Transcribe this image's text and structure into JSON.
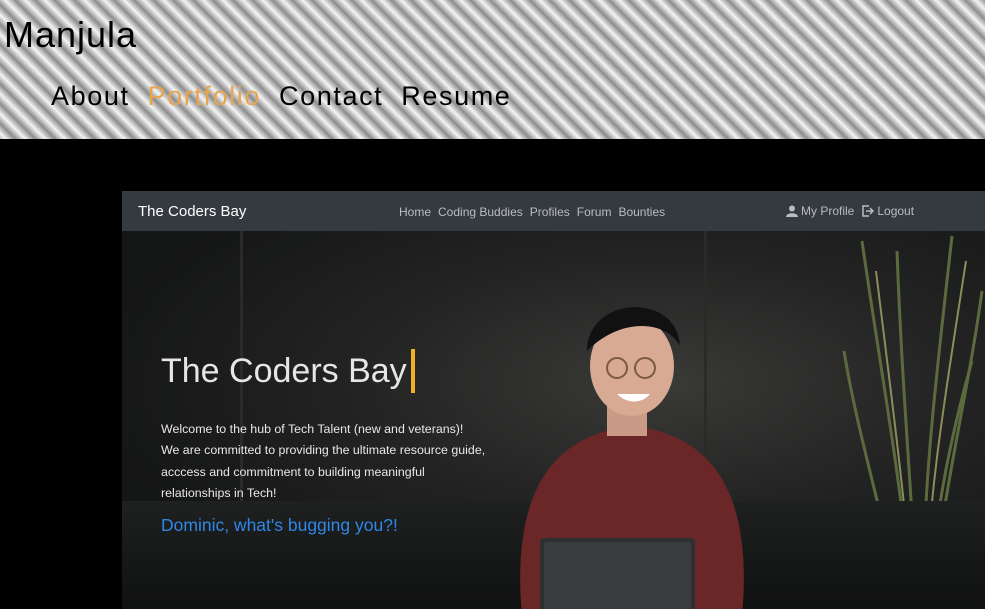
{
  "site": {
    "brand": "Manjula",
    "nav": [
      {
        "label": "About",
        "active": false
      },
      {
        "label": "Portfolio",
        "active": true
      },
      {
        "label": "Contact",
        "active": false
      },
      {
        "label": "Resume",
        "active": false
      }
    ],
    "accent_color": "#e8a54f"
  },
  "screenshot": {
    "navbar": {
      "brand": "The Coders Bay",
      "links": [
        "Home",
        "Coding Buddies",
        "Profiles",
        "Forum",
        "Bounties"
      ],
      "profile_label": "My Profile",
      "profile_icon": "user-icon",
      "logout_label": "Logout",
      "logout_icon": "logout-icon"
    },
    "hero": {
      "title": "The Coders Bay",
      "lines": [
        "Welcome to the hub of Tech Talent (new and veterans)!",
        "We are committed to providing the ultimate resource guide,",
        "acccess and commitment to building meaningful",
        "relationships in Tech!"
      ],
      "cta": "Dominic, what's bugging you?!",
      "cta_color": "#2f87e8",
      "cursor_color": "#f0b020"
    }
  }
}
